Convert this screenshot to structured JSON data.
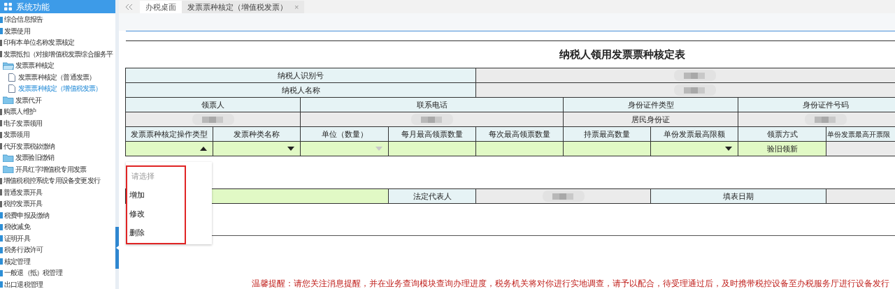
{
  "sidebar": {
    "title": "系统功能",
    "items": [
      {
        "label": "综合信息报告",
        "kind": "module",
        "selected": false
      },
      {
        "label": "发票使用",
        "kind": "module",
        "selected": false,
        "children": [
          {
            "label": "印有本单位名称发票核定",
            "kind": "page",
            "selected": false
          },
          {
            "label": "发票抵扣（对接增值税发票综合服务平",
            "kind": "page",
            "selected": false
          },
          {
            "label": "发票票种核定",
            "kind": "folder",
            "expanded": true,
            "selected": false,
            "children": [
              {
                "label": "发票票种核定（普通发票）",
                "kind": "leaf",
                "selected": false
              },
              {
                "label": "发票票种核定（增值税发票）",
                "kind": "leaf",
                "selected": true
              }
            ]
          },
          {
            "label": "发票代开",
            "kind": "folder",
            "expanded": false,
            "selected": false
          },
          {
            "label": "购票人维护",
            "kind": "page",
            "selected": false
          },
          {
            "label": "电子发票领用",
            "kind": "page",
            "selected": false
          },
          {
            "label": "发票领用",
            "kind": "page",
            "selected": false
          },
          {
            "label": "代开发票税款缴纳",
            "kind": "page",
            "selected": false
          },
          {
            "label": "发票验旧缴销",
            "kind": "folder",
            "expanded": false,
            "selected": false
          },
          {
            "label": "开具红字增值税专用发票",
            "kind": "folder",
            "expanded": false,
            "selected": false
          },
          {
            "label": "增值税税控系统专用设备变更发行",
            "kind": "page",
            "selected": false
          },
          {
            "label": "普通发票开具",
            "kind": "page",
            "selected": false
          },
          {
            "label": "税控发票开具",
            "kind": "page",
            "selected": false
          }
        ]
      },
      {
        "label": "税费申报及缴纳",
        "kind": "module",
        "selected": false
      },
      {
        "label": "税收减免",
        "kind": "module",
        "selected": false
      },
      {
        "label": "证明开具",
        "kind": "module",
        "selected": false
      },
      {
        "label": "税务行政许可",
        "kind": "module",
        "selected": false
      },
      {
        "label": "核定管理",
        "kind": "module",
        "selected": false
      },
      {
        "label": "一般退（抵）税管理",
        "kind": "module",
        "selected": false
      },
      {
        "label": "出口退税管理",
        "kind": "module",
        "selected": false
      }
    ]
  },
  "tabs": [
    {
      "label": "办税桌面",
      "selected": false
    },
    {
      "label": "发票票种核定（增值税发票）",
      "selected": true,
      "close_glyph": "×"
    }
  ],
  "form": {
    "title": "纳税人领用发票票种核定表",
    "taxpayer_rows": [
      {
        "label": "纳税人识别号"
      },
      {
        "label": "纳税人名称"
      }
    ],
    "contact_headers": [
      "领票人",
      "联系电话",
      "身份证件类型",
      "身份证件号码"
    ],
    "contact_values": [
      {
        "kind": "redacted"
      },
      {
        "kind": "redacted"
      },
      {
        "kind": "text",
        "value": "居民身份证"
      },
      {
        "kind": "redacted"
      }
    ],
    "detail_columns": [
      "发票票种核定操作类型",
      "发票种类名称",
      "单位（数量）",
      "每月最高领票数量",
      "每次最高领票数量",
      "持票最高数量",
      "单份发票最高限额",
      "领票方式",
      "单份发票最高开票限"
    ],
    "detail_inputs": [
      {
        "kind": "select",
        "open": true,
        "disabled": false
      },
      {
        "kind": "select",
        "open": false,
        "disabled": false
      },
      {
        "kind": "select",
        "open": false,
        "disabled": true
      },
      {
        "kind": "input"
      },
      {
        "kind": "input"
      },
      {
        "kind": "input"
      },
      {
        "kind": "select",
        "open": false,
        "disabled": false
      },
      {
        "kind": "text",
        "value": "验旧领新"
      },
      {
        "kind": "readonly"
      }
    ],
    "footer_row": [
      {
        "kind": "input"
      },
      {
        "kind": "label",
        "text": "法定代表人"
      },
      {
        "kind": "redacted"
      },
      {
        "kind": "label",
        "text": "填表日期"
      },
      {
        "kind": "readonly"
      }
    ],
    "dropdown": {
      "highlight_box": true,
      "options": [
        {
          "label": "请选择",
          "kind": "placeholder"
        },
        {
          "label": "增加",
          "kind": "option"
        },
        {
          "label": "修改",
          "kind": "option"
        },
        {
          "label": "删除",
          "kind": "option"
        }
      ]
    },
    "notice": "温馨提醒：请您关注消息提醒，并在业务查询模块查询办理进度，税务机关将对你进行实地调查，请予以配合，待受理通过后，及时携带税控设备至办税服务厅进行设备发行"
  }
}
